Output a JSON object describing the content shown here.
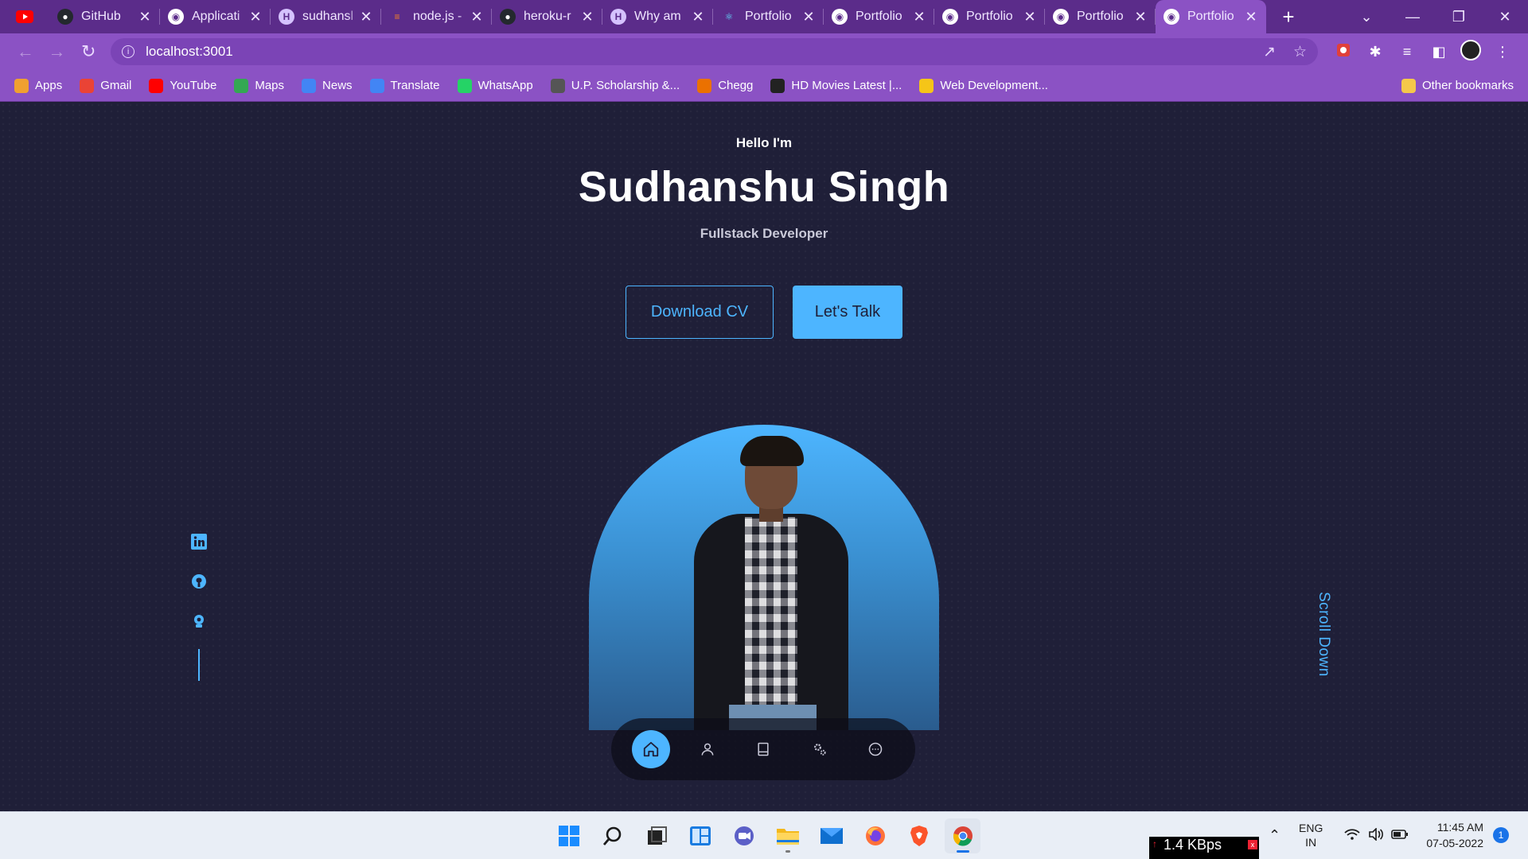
{
  "browser": {
    "tabs": [
      {
        "title": "GitHub",
        "icon": "github-icon"
      },
      {
        "title": "Applicati",
        "icon": "globe-icon"
      },
      {
        "title": "sudhansl",
        "icon": "hashnode-icon"
      },
      {
        "title": "node.js -",
        "icon": "stackoverflow-icon"
      },
      {
        "title": "heroku-r",
        "icon": "github-icon"
      },
      {
        "title": "Why am",
        "icon": "hashnode-icon"
      },
      {
        "title": "Portfolio",
        "icon": "react-icon"
      },
      {
        "title": "Portfolio",
        "icon": "globe-icon"
      },
      {
        "title": "Portfolio",
        "icon": "globe-icon"
      },
      {
        "title": "Portfolio",
        "icon": "globe-icon"
      },
      {
        "title": "Portfolio",
        "icon": "globe-icon",
        "active": true
      }
    ],
    "url": "localhost:3001",
    "bookmarks": [
      {
        "label": "Apps",
        "icon": "apps-grid-icon",
        "color": "#f0a030"
      },
      {
        "label": "Gmail",
        "icon": "gmail-icon",
        "color": "#ea4335"
      },
      {
        "label": "YouTube",
        "icon": "youtube-icon",
        "color": "#ff0000"
      },
      {
        "label": "Maps",
        "icon": "maps-icon",
        "color": "#34a853"
      },
      {
        "label": "News",
        "icon": "news-icon",
        "color": "#4285f4"
      },
      {
        "label": "Translate",
        "icon": "translate-icon",
        "color": "#4285f4"
      },
      {
        "label": "WhatsApp",
        "icon": "whatsapp-icon",
        "color": "#25d366"
      },
      {
        "label": "U.P. Scholarship &...",
        "icon": "globe-icon",
        "color": "#555555"
      },
      {
        "label": "Chegg",
        "icon": "chegg-icon",
        "color": "#eb7100"
      },
      {
        "label": "HD Movies Latest |...",
        "icon": "movie-icon",
        "color": "#222222"
      },
      {
        "label": "Web Development...",
        "icon": "webdev-icon",
        "color": "#f5c518"
      }
    ],
    "other_bookmarks": "Other bookmarks"
  },
  "hero": {
    "greeting": "Hello I'm",
    "name": "Sudhanshu Singh",
    "role": "Fullstack Developer",
    "download_cv": "Download CV",
    "lets_talk": "Let's Talk",
    "scroll_down": "Scroll Down"
  },
  "socials": [
    "linkedin-icon",
    "github-icon",
    "hashnode-icon"
  ],
  "bottom_nav": [
    "home-icon",
    "user-icon",
    "book-icon",
    "settings-icon",
    "message-icon"
  ],
  "colors": {
    "accent": "#4db5ff",
    "background": "#1f1f38",
    "browser_frame": "#8b52c4"
  },
  "taskbar": {
    "net_speed": "1.4 KBps",
    "lang_top": "ENG",
    "lang_bottom": "IN",
    "time": "11:45 AM",
    "date": "07-05-2022",
    "notification_count": "1"
  }
}
